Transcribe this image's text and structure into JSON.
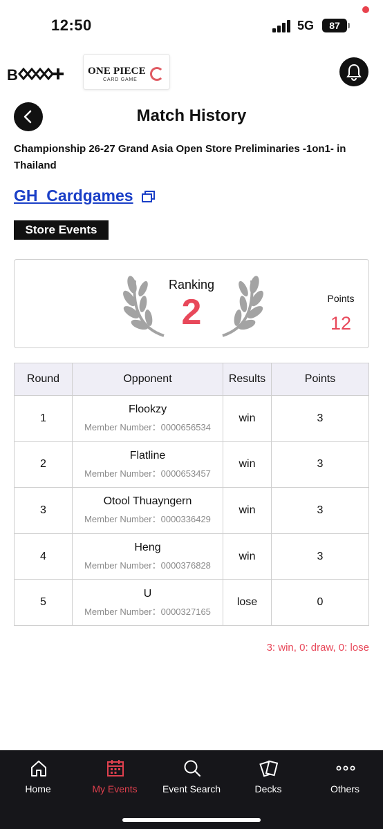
{
  "status_bar": {
    "time": "12:50",
    "network": "5G",
    "battery": "87"
  },
  "header": {
    "brand_logo": "B+CG+",
    "game_logo_title": "ONE PIECE",
    "game_logo_sub": "CARD GAME"
  },
  "page": {
    "title": "Match History",
    "event_name": "Championship 26-27 Grand Asia Open Store Preliminaries -1on1- in Thailand",
    "store_name": "GH_Cardgames",
    "tag": "Store Events"
  },
  "ranking": {
    "label": "Ranking",
    "value": "2",
    "points_label": "Points",
    "points_value": "12"
  },
  "table": {
    "headers": {
      "round": "Round",
      "opponent": "Opponent",
      "results": "Results",
      "points": "Points"
    },
    "rows": [
      {
        "round": "1",
        "name": "Flookzy",
        "member": "Member Number：0000656534",
        "result": "win",
        "points": "3"
      },
      {
        "round": "2",
        "name": "Flatline",
        "member": "Member Number：0000653457",
        "result": "win",
        "points": "3"
      },
      {
        "round": "3",
        "name": "Otool Thuayngern",
        "member": "Member Number：0000336429",
        "result": "win",
        "points": "3"
      },
      {
        "round": "4",
        "name": "Heng",
        "member": "Member Number：0000376828",
        "result": "win",
        "points": "3"
      },
      {
        "round": "5",
        "name": "U",
        "member": "Member Number：0000327165",
        "result": "lose",
        "points": "0"
      }
    ]
  },
  "legend": "3: win, 0: draw, 0: lose",
  "nav": {
    "items": [
      {
        "label": "Home",
        "icon": "home-icon"
      },
      {
        "label": "My Events",
        "icon": "calendar-icon"
      },
      {
        "label": "Event Search",
        "icon": "search-icon"
      },
      {
        "label": "Decks",
        "icon": "cards-icon"
      },
      {
        "label": "Others",
        "icon": "more-icon"
      }
    ],
    "active_index": 1
  },
  "colors": {
    "accent": "#e8485a",
    "link": "#1a3fc7",
    "nav_bg": "#16161a",
    "header_cell_bg": "#efeef6"
  }
}
